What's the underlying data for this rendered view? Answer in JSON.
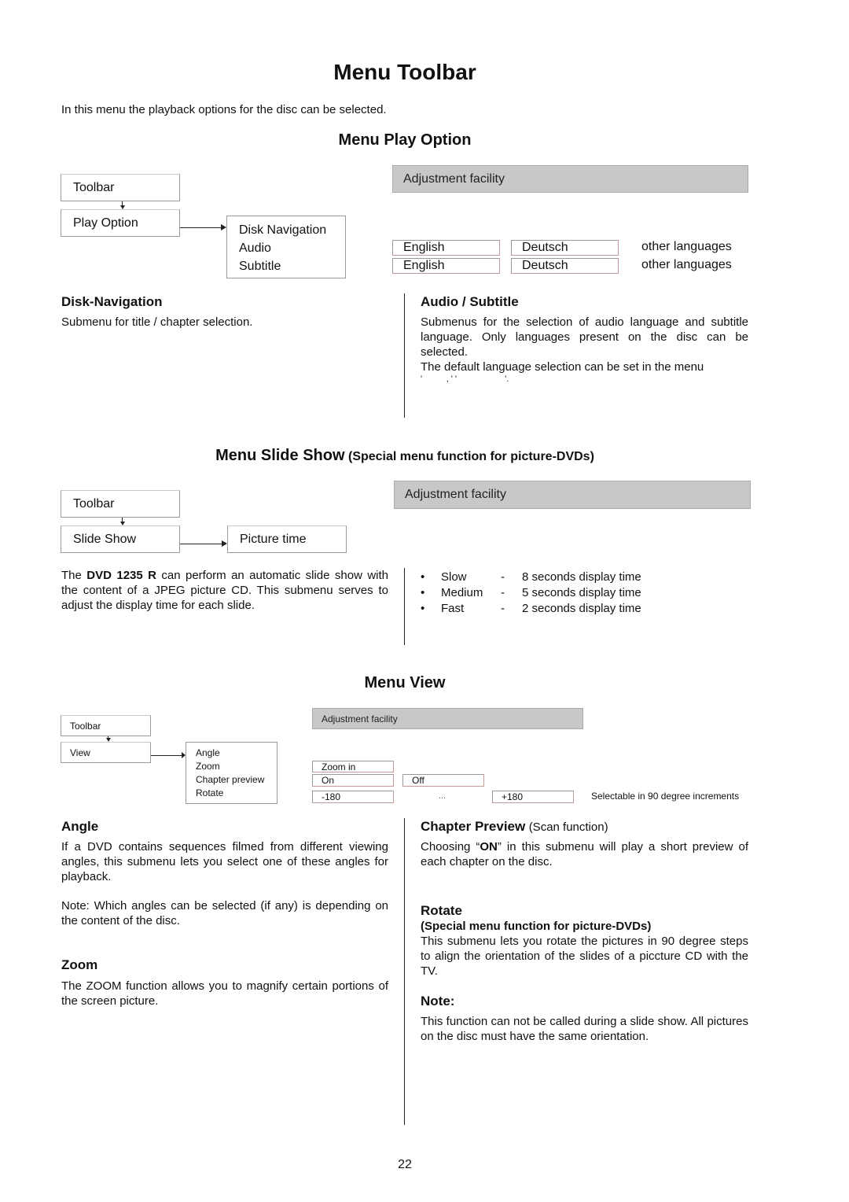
{
  "title": "Menu Toolbar",
  "intro": "In this menu the playback options for the disc can be selected.",
  "play_option": {
    "heading": "Menu Play Option",
    "toolbar": "Toolbar",
    "menu": "Play Option",
    "submenu": [
      "Disk Navigation",
      "Audio",
      "Subtitle"
    ],
    "adjustment": "Adjustment facility",
    "rows": [
      [
        "English",
        "Deutsch",
        "other languages"
      ],
      [
        "English",
        "Deutsch",
        "other languages"
      ]
    ],
    "left_heading": "Disk-Navigation",
    "left_text": "Submenu for title / chapter selection.",
    "right_heading": "Audio / Subtitle",
    "right_text": "Submenus for the selection of audio language and subtitle language. Only languages present on the disc can be selected.",
    "right_text2": "The default language selection can be set in the menu",
    "right_text3": "'          , ' '                    '."
  },
  "slide_show": {
    "heading": "Menu Slide Show",
    "heading_note": "(Special menu function for picture-DVDs)",
    "toolbar": "Toolbar",
    "menu": "Slide Show",
    "submenu": "Picture time",
    "adjustment": "Adjustment facility",
    "text_pre": "The ",
    "text_bold": "DVD 1235 R",
    "text_post": " can perform an automatic slide show with the content of a JPEG picture CD. This submenu serves to adjust the display time for each slide.",
    "options": [
      {
        "label": "Slow",
        "dash": "-",
        "desc": "8 seconds display time"
      },
      {
        "label": "Medium",
        "dash": "-",
        "desc": "5 seconds display time"
      },
      {
        "label": "Fast",
        "dash": "-",
        "desc": "2 seconds display time"
      }
    ]
  },
  "view": {
    "heading": "Menu View",
    "toolbar": "Toolbar",
    "menu": "View",
    "submenu": [
      "Angle",
      "Zoom",
      "Chapter preview",
      "Rotate"
    ],
    "adjustment": "Adjustment facility",
    "zoom_in": "Zoom in",
    "on": "On",
    "off": "Off",
    "min": "-180",
    "dots": "...",
    "max": "+180",
    "rotate_note": "Selectable in 90 degree increments",
    "angle_heading": "Angle",
    "angle_text": "If a DVD contains sequences filmed from different viewing angles, this submenu lets you select one of these angles for playback.",
    "angle_note": "Note: Which angles can be selected (if any) is depending on the content of the disc.",
    "zoom_heading": "Zoom",
    "zoom_text": "The ZOOM function allows you to magnify certain portions of the screen picture.",
    "chapter_heading": "Chapter Preview",
    "chapter_heading_note": "(Scan function)",
    "chapter_pre": "Choosing “",
    "chapter_bold": "ON",
    "chapter_post": "” in this submenu will play a short preview of each chapter on the disc.",
    "rotate_heading": "Rotate",
    "rotate_sub": "(Special menu function for picture-DVDs)",
    "rotate_text": "This submenu lets you rotate the pictures in 90 degree steps to align the orientation of the slides of a piccture CD with the TV.",
    "note_heading": "Note:",
    "note_text": "This function can not be called during a slide show. All pictures on the disc must have the same orientation."
  },
  "page_number": "22"
}
